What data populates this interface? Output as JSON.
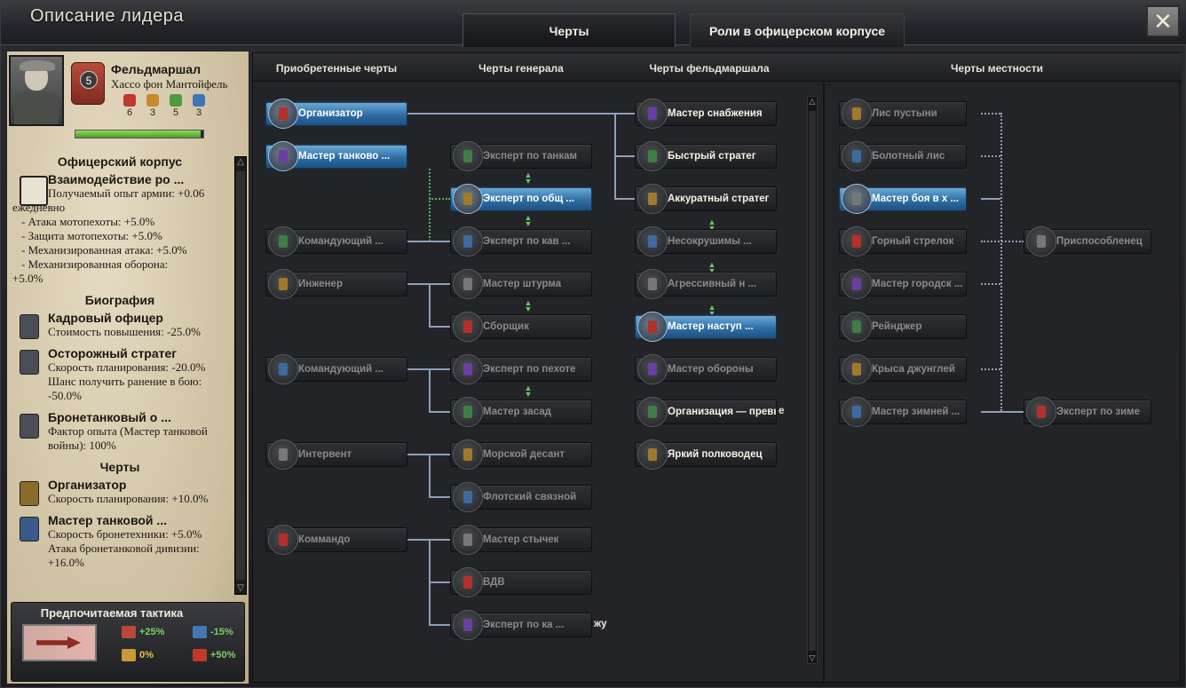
{
  "window": {
    "title": "Описание лидера",
    "close_glyph": "✕"
  },
  "tabs": [
    {
      "label": "Черты"
    },
    {
      "label": "Роли в офицерском корпусе"
    }
  ],
  "leader": {
    "rank": "Фельдмаршал",
    "name": "Хассо фон Мантойфель",
    "level": "5",
    "stats": [
      {
        "icon": "attack-icon",
        "value": "6",
        "color": "#c0392b"
      },
      {
        "icon": "defense-icon",
        "value": "3",
        "color": "#c98a2a"
      },
      {
        "icon": "planning-icon",
        "value": "5",
        "color": "#4f9a3c"
      },
      {
        "icon": "logistics-icon",
        "value": "3",
        "color": "#3d78b5"
      }
    ],
    "xp_fraction": 0.98
  },
  "officer_corps": {
    "heading": "Офицерский корпус",
    "entry": {
      "title": "Взаимодействие ро ...",
      "lines": [
        "Получаемый опыт армии: +0.06",
        "ежедневно"
      ],
      "sub": [
        "- Атака мотопехоты: +5.0%",
        "- Защита мотопехоты: +5.0%",
        "- Механизированная атака: +5.0%",
        "- Механизированная оборона:"
      ],
      "tail": "+5.0%"
    }
  },
  "biography": {
    "heading": "Биография",
    "entries": [
      {
        "title": "Кадровый офицер",
        "lines": [
          "Стоимость повышения: -25.0%"
        ]
      },
      {
        "title": "Осторожный стратег",
        "lines": [
          "Скорость планирования: -20.0%",
          "Шанс получить ранение в бою:",
          "-50.0%"
        ]
      },
      {
        "title": "Бронетанковый о ...",
        "lines": [
          "Фактор опыта (Мастер танковой",
          "войны): 100%"
        ]
      }
    ]
  },
  "traits_section": {
    "heading": "Черты",
    "entries": [
      {
        "title": "Организатор",
        "lines": [
          "Скорость планирования: +10.0%"
        ]
      },
      {
        "title": "Мастер танковой  ...",
        "lines": [
          "Скорость бронетехники: +5.0%",
          "Атака бронетанковой дивизии:",
          "+16.0%"
        ]
      }
    ]
  },
  "tactic": {
    "heading": "Предпочитаемая тактика",
    "values": [
      {
        "label": "+25%",
        "color": "#7bd06a",
        "icon": "attack-arrows-icon"
      },
      {
        "label": "-15%",
        "color": "#7bd06a",
        "icon": "defense-shield-icon"
      },
      {
        "label": "0%",
        "color": "#e7c24a",
        "icon": "movement-icon"
      },
      {
        "label": "+50%",
        "color": "#7bd06a",
        "icon": "breakthrough-icon"
      }
    ]
  },
  "columns": {
    "acquired": "Приобретенные черты",
    "general": "Черты генерала",
    "fieldmarshal": "Черты фельдмаршала",
    "terrain": "Черты местности"
  },
  "traits": {
    "acquired": [
      {
        "label": "Организатор",
        "state": "on"
      },
      {
        "label": "Мастер танково ...",
        "state": "on"
      },
      {
        "label": "Командующий ...",
        "state": "dim"
      },
      {
        "label": "Инженер",
        "state": "dim"
      },
      {
        "label": "Командующий ...",
        "state": "dim"
      },
      {
        "label": "Интервент",
        "state": "dim"
      },
      {
        "label": "Коммандо",
        "state": "dim"
      }
    ],
    "general": [
      {
        "label": "Эксперт по танкам",
        "state": "dim"
      },
      {
        "label": "Эксперт по общ ...",
        "state": "on"
      },
      {
        "label": "Эксперт по кав ...",
        "state": "dim"
      },
      {
        "label": "Мастер штурма",
        "state": "dim"
      },
      {
        "label": "Сборщик",
        "state": "dim"
      },
      {
        "label": "Эксперт по пехоте",
        "state": "dim"
      },
      {
        "label": "Мастер засад",
        "state": "dim"
      },
      {
        "label": "Морской десант",
        "state": "dim"
      },
      {
        "label": "Флотский связной",
        "state": "dim"
      },
      {
        "label": "Мастер стычек",
        "state": "dim"
      },
      {
        "label": "ВДВ",
        "state": "dim"
      },
      {
        "label": "Эксперт по ка ...",
        "state": "dim",
        "overflow": "жу"
      }
    ],
    "fieldmarshal": [
      {
        "label": "Мастер снабжения",
        "state": "bright"
      },
      {
        "label": "Быстрый стратег",
        "state": "bright"
      },
      {
        "label": "Аккуратный стратег",
        "state": "bright"
      },
      {
        "label": "Несокрушимы ...",
        "state": "dim"
      },
      {
        "label": "Агрессивный н ...",
        "state": "dim"
      },
      {
        "label": "Мастер наступ ...",
        "state": "on"
      },
      {
        "label": "Мастер обороны",
        "state": "dim"
      },
      {
        "label": "Организация — превыше",
        "state": "bright",
        "overflow": "е"
      },
      {
        "label": "Яркий полководец",
        "state": "bright"
      }
    ],
    "terrain": [
      {
        "label": "Лис пустыни",
        "state": "dim"
      },
      {
        "label": "Болотный лис",
        "state": "dim"
      },
      {
        "label": "Мастер боя в х ...",
        "state": "on"
      },
      {
        "label": "Горный стрелок",
        "state": "dim"
      },
      {
        "label": "Мастер городск ...",
        "state": "dim"
      },
      {
        "label": "Рейнджер",
        "state": "dim"
      },
      {
        "label": "Крыса джунглей",
        "state": "dim"
      },
      {
        "label": "Мастер зимней ...",
        "state": "dim"
      },
      {
        "label": "Приспособленец",
        "state": "dim"
      },
      {
        "label": "Эксперт по зиме",
        "state": "dim"
      }
    ]
  },
  "icons": [
    "close-icon",
    "portrait-icon",
    "rank-badge-icon",
    "tank-icon",
    "scroll-up-icon",
    "scroll-down-icon",
    "medal-icon"
  ]
}
